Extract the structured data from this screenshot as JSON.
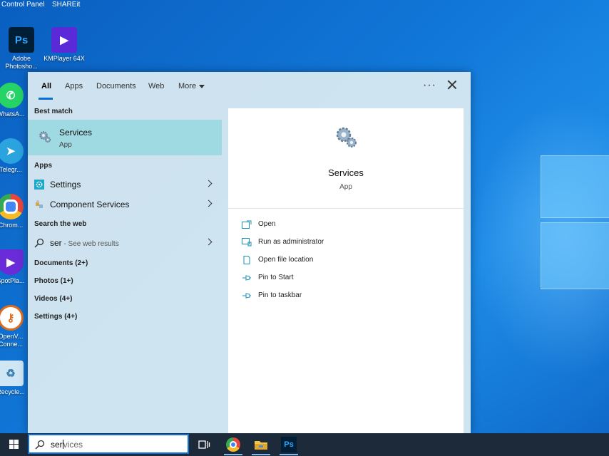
{
  "desktop": {
    "top_labels": [
      "Control Panel",
      "SHAREit"
    ],
    "icons": [
      {
        "label": "Adobe Photosho...",
        "glyph": "Ps",
        "color": "#001e36",
        "fg": "#31a8ff"
      },
      {
        "label": "KMPlayer 64X",
        "glyph": "▶",
        "color": "#5a2ad8",
        "fg": "#ffffff"
      },
      {
        "label": "WhatsA...",
        "glyph": "✆",
        "color": "#25d366",
        "fg": "#ffffff"
      },
      {
        "label": "Telegr...",
        "glyph": "➤",
        "color": "#2aa3df",
        "fg": "#ffffff"
      },
      {
        "label": "Chrom...",
        "glyph": "",
        "color": "#e8453c",
        "fg": "#ffffff"
      },
      {
        "label": "SpotPla...",
        "glyph": "▶",
        "color": "#6a2bd8",
        "fg": "#ffffff"
      },
      {
        "label": "OpenV... Conne...",
        "glyph": "⚷",
        "color": "#ffffff",
        "fg": "#e06a1b"
      },
      {
        "label": "Recycle...",
        "glyph": "♻",
        "color": "#cfe6f4",
        "fg": "#3a7fb0"
      }
    ]
  },
  "search_panel": {
    "tabs": [
      {
        "label": "All",
        "active": true
      },
      {
        "label": "Apps",
        "active": false
      },
      {
        "label": "Documents",
        "active": false
      },
      {
        "label": "Web",
        "active": false
      },
      {
        "label": "More",
        "active": false
      }
    ],
    "ellipsis": "···",
    "best_match_heading": "Best match",
    "best_match": {
      "title": "Services",
      "subtitle": "App"
    },
    "apps_heading": "Apps",
    "apps": [
      {
        "label": "Settings",
        "icon": "gear-icon"
      },
      {
        "label_prefix": "Component ",
        "label_bold": "Services",
        "icon": "component-services-icon"
      }
    ],
    "web_heading": "Search the web",
    "web_result": {
      "query": "ser",
      "suffix": " - See web results"
    },
    "categories": [
      "Documents (2+)",
      "Photos (1+)",
      "Videos (4+)",
      "Settings (4+)"
    ],
    "preview": {
      "title": "Services",
      "subtitle": "App",
      "actions": [
        {
          "label": "Open",
          "icon": "open-icon"
        },
        {
          "label": "Run as administrator",
          "icon": "shield-icon"
        },
        {
          "label": "Open file location",
          "icon": "file-location-icon"
        },
        {
          "label": "Pin to Start",
          "icon": "pin-icon"
        },
        {
          "label": "Pin to taskbar",
          "icon": "pin-icon"
        }
      ]
    }
  },
  "taskbar": {
    "search": {
      "typed": "ser",
      "suggestion": "vices"
    },
    "accent": "#0a6fd8"
  }
}
